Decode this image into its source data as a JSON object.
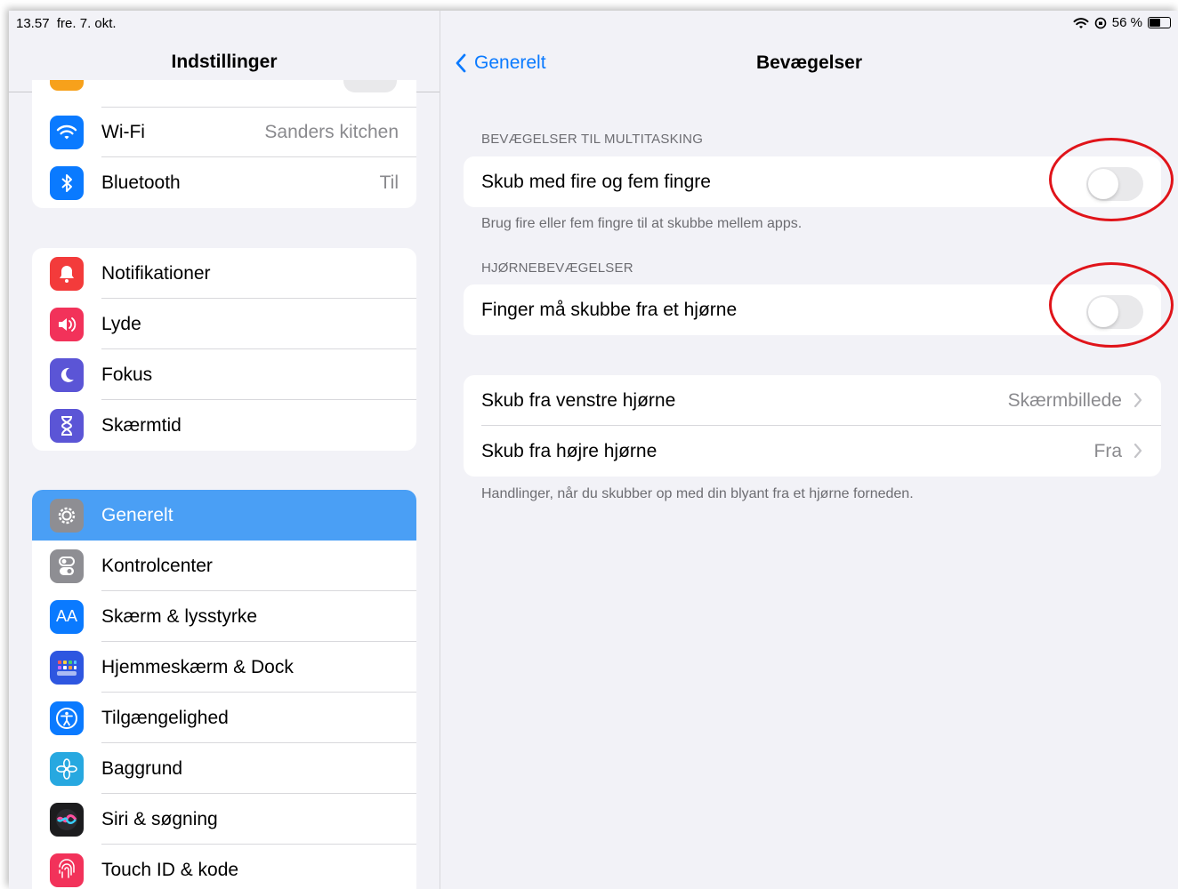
{
  "status": {
    "time": "13.57",
    "date": "fre. 7. okt.",
    "battery": "56 %"
  },
  "sidebar": {
    "title": "Indstillinger",
    "group1": [
      {
        "label": "Wi-Fi",
        "value": "Sanders kitchen",
        "icon": "wifi-icon",
        "color": "#0a7aff"
      },
      {
        "label": "Bluetooth",
        "value": "Til",
        "icon": "bluetooth-icon",
        "color": "#0a7aff"
      }
    ],
    "group2": [
      {
        "label": "Notifikationer",
        "icon": "bell-icon",
        "color": "#f33b3b"
      },
      {
        "label": "Lyde",
        "icon": "speaker-icon",
        "color": "#f2325a"
      },
      {
        "label": "Fokus",
        "icon": "moon-icon",
        "color": "#5b55d6"
      },
      {
        "label": "Skærmtid",
        "icon": "hourglass-icon",
        "color": "#5b55d6"
      }
    ],
    "group3": [
      {
        "label": "Generelt",
        "icon": "gear-icon",
        "color": "#8e8e93",
        "selected": true
      },
      {
        "label": "Kontrolcenter",
        "icon": "toggles-icon",
        "color": "#8e8e93"
      },
      {
        "label": "Skærm & lysstyrke",
        "icon": "text-size-icon",
        "color": "#0a7aff",
        "icon_text": "AA"
      },
      {
        "label": "Hjemmeskærm & Dock",
        "icon": "app-grid-icon",
        "color": "#2e56e0"
      },
      {
        "label": "Tilgængelighed",
        "icon": "accessibility-icon",
        "color": "#0a7aff"
      },
      {
        "label": "Baggrund",
        "icon": "flower-icon",
        "color": "#27a8e0"
      },
      {
        "label": "Siri & søgning",
        "icon": "siri-icon",
        "color": "#222"
      },
      {
        "label": "Touch ID & kode",
        "icon": "fingerprint-icon",
        "color": "#f2325a"
      }
    ]
  },
  "detail": {
    "back_label": "Generelt",
    "title": "Bevægelser",
    "section1_header": "BEVÆGELSER TIL MULTITASKING",
    "section1_row": "Skub med fire og fem fingre",
    "section1_toggle": false,
    "section1_footer": "Brug fire eller fem fingre til at skubbe mellem apps.",
    "section2_header": "HJØRNEBEVÆGELSER",
    "section2_row": "Finger må skubbe fra et hjørne",
    "section2_toggle": false,
    "section3_rows": [
      {
        "label": "Skub fra venstre hjørne",
        "value": "Skærmbillede"
      },
      {
        "label": "Skub fra højre hjørne",
        "value": "Fra"
      }
    ],
    "section3_footer": "Handlinger, når du skubber op med din blyant fra et hjørne forneden."
  },
  "colors": {
    "accent": "#0a7aff",
    "selected_row": "#4a9ff5",
    "annotation": "#e0141a"
  }
}
